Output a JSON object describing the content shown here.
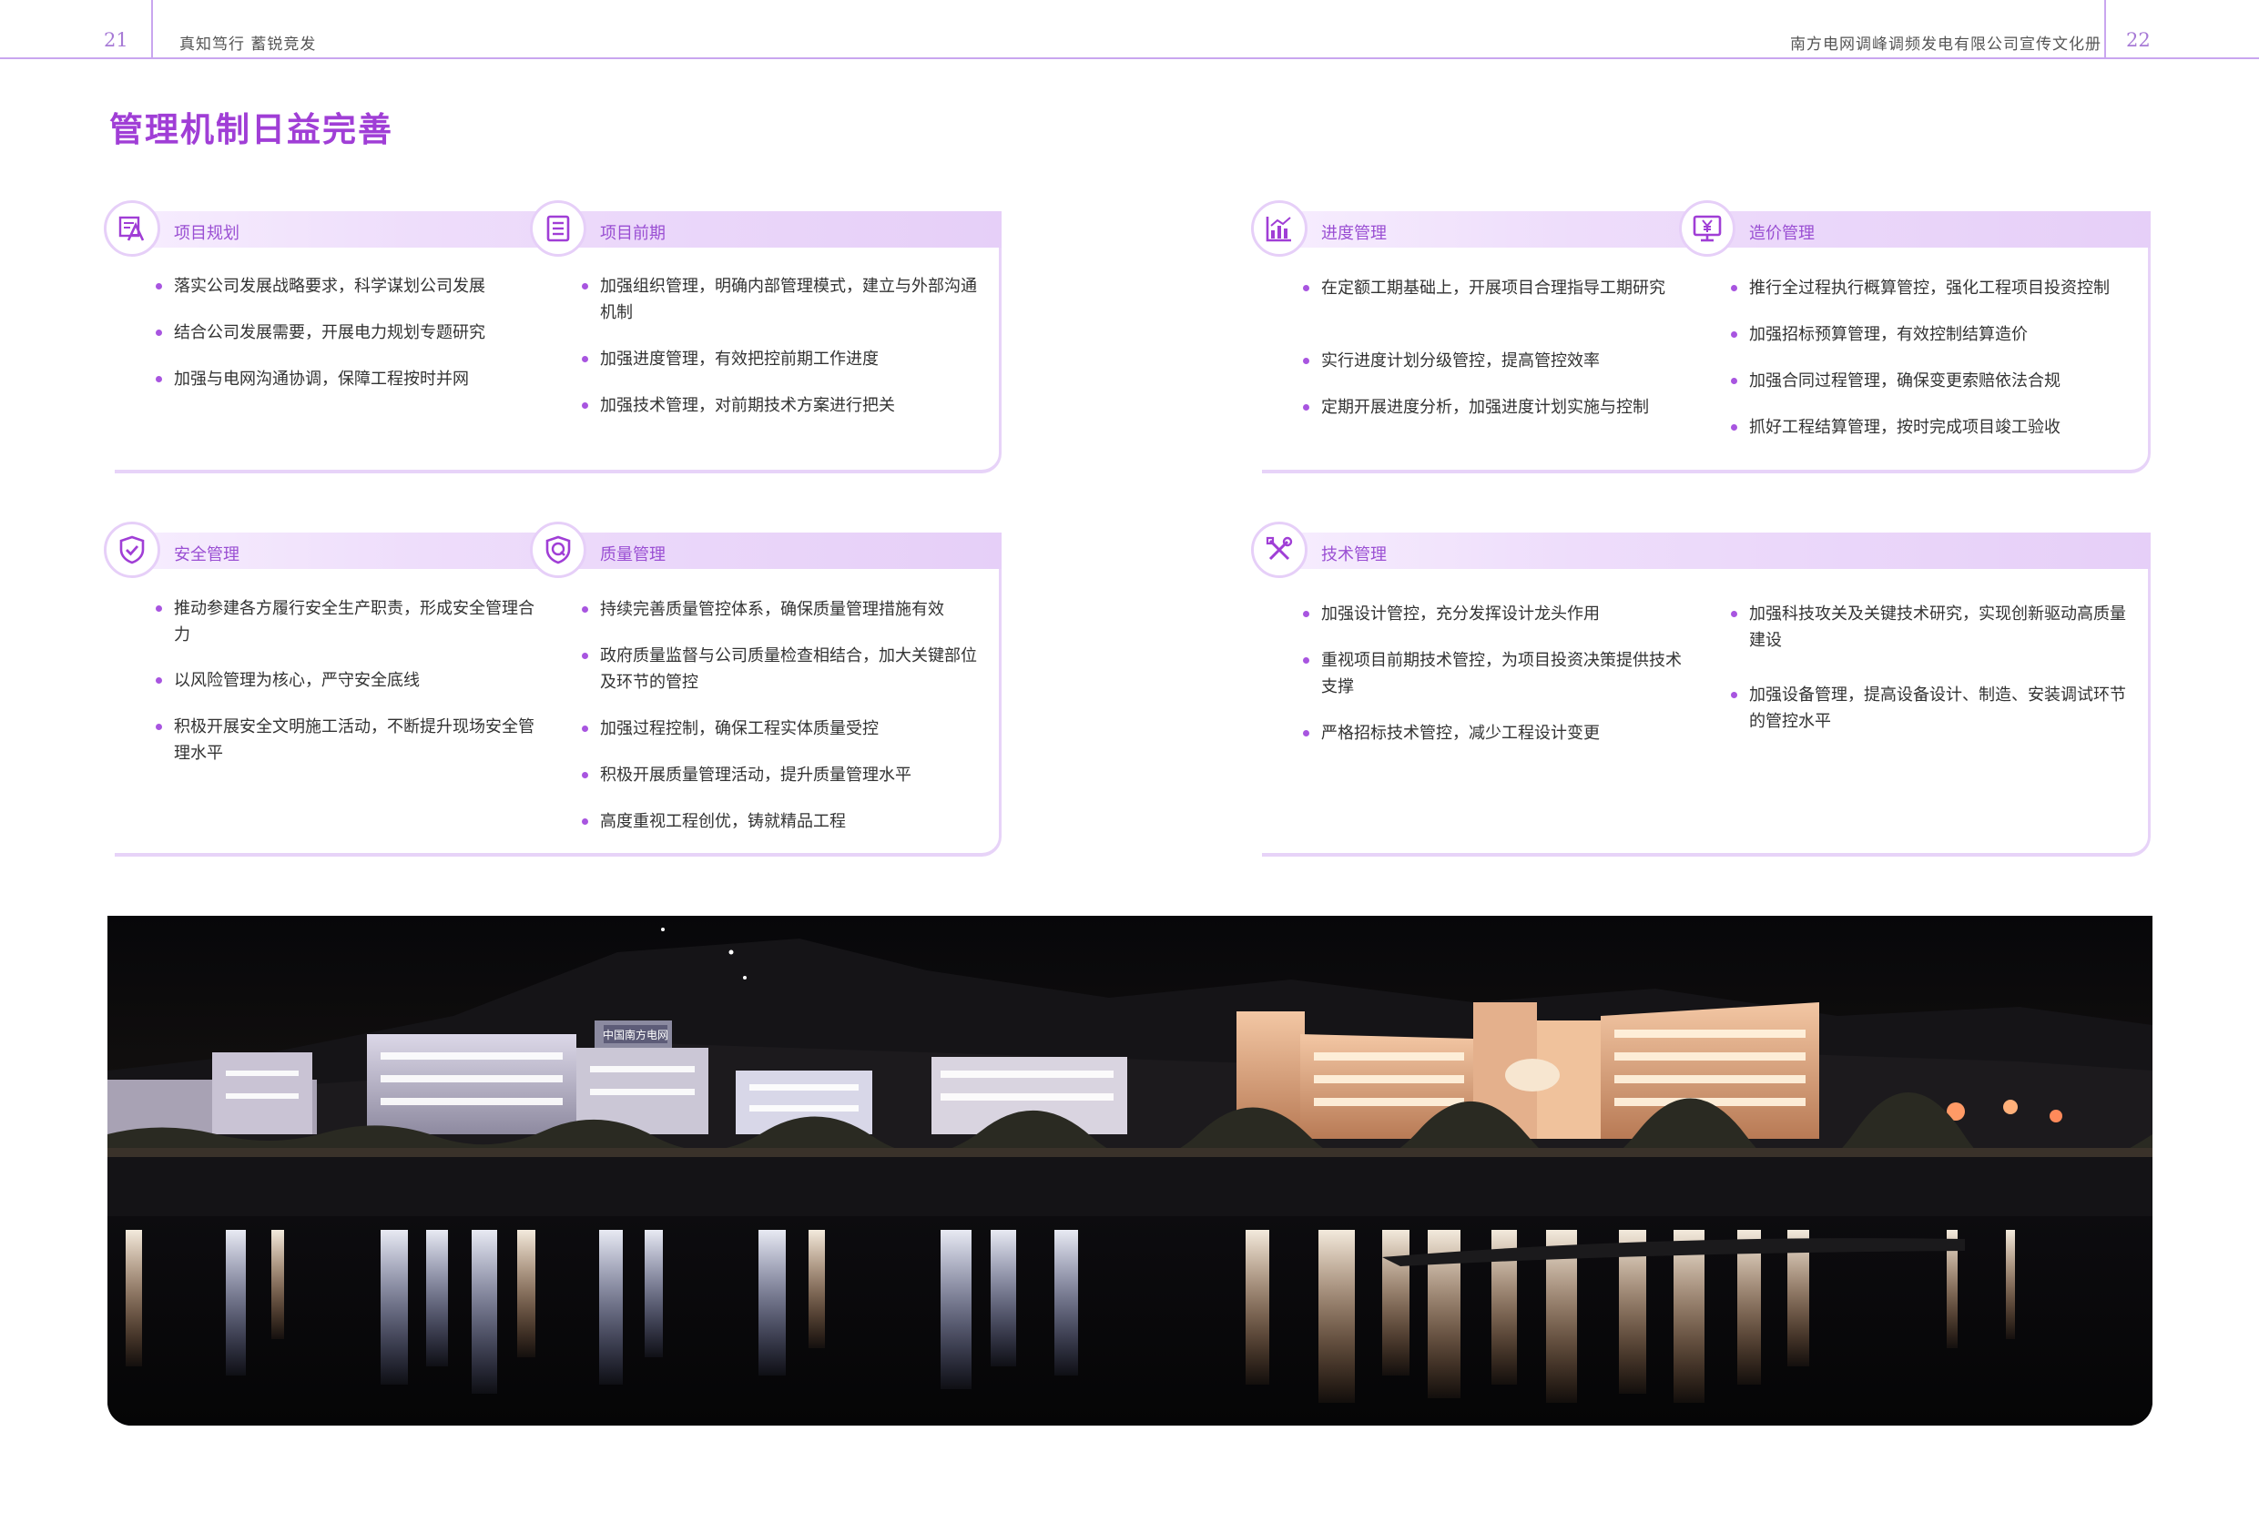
{
  "header": {
    "page_left": "21",
    "slogan": "真知笃行  蓄锐竞发",
    "company": "南方电网调峰调频发电有限公司宣传文化册",
    "page_right": "22"
  },
  "title": "管理机制日益完善",
  "colors": {
    "accent": "#a03ed6",
    "bar": "#e6cff8",
    "bullet": "#a855e0"
  },
  "sections": [
    {
      "title": "项目规划",
      "icon": "pencil-ruler-icon",
      "items": [
        "落实公司发展战略要求，科学谋划公司发展",
        "结合公司发展需要，开展电力规划专题研究",
        "加强与电网沟通协调，保障工程按时并网"
      ]
    },
    {
      "title": "项目前期",
      "icon": "document-list-icon",
      "items": [
        "加强组织管理，明确内部管理模式，建立与外部沟通机制",
        "加强进度管理，有效把控前期工作进度",
        "加强技术管理，对前期技术方案进行把关"
      ]
    },
    {
      "title": "进度管理",
      "icon": "bar-chart-icon",
      "items": [
        "在定额工期基础上，开展项目合理指导工期研究",
        "实行进度计划分级管控，提高管控效率",
        "定期开展进度分析，加强进度计划实施与控制"
      ]
    },
    {
      "title": "造价管理",
      "icon": "monitor-yen-icon",
      "items": [
        "推行全过程执行概算管控，强化工程项目投资控制",
        "加强招标预算管理，有效控制结算造价",
        "加强合同过程管理，确保变更索赔依法合规",
        "抓好工程结算管理，按时完成项目竣工验收"
      ]
    },
    {
      "title": "安全管理",
      "icon": "shield-check-icon",
      "items": [
        "推动参建各方履行安全生产职责，形成安全管理合力",
        "以风险管理为核心，严守安全底线",
        "积极开展安全文明施工活动，不断提升现场安全管理水平"
      ]
    },
    {
      "title": "质量管理",
      "icon": "quality-badge-icon",
      "items": [
        "持续完善质量管控体系，确保质量管理措施有效",
        "政府质量监督与公司质量检查相结合，加大关键部位及环节的管控",
        "加强过程控制，确保工程实体质量受控",
        "积极开展质量管理活动，提升质量管理水平",
        "高度重视工程创优，铸就精品工程"
      ]
    },
    {
      "title": "技术管理",
      "icon": "tools-icon",
      "items": [
        "加强设计管控，充分发挥设计龙头作用",
        "重视项目前期技术管控，为项目投资决策提供技术支撑",
        "严格招标技术管控，减少工程设计变更"
      ]
    },
    {
      "title": "技术管理-col2",
      "icon": "",
      "items": [
        "加强科技攻关及关键技术研究，实现创新驱动高质量建设",
        "加强设备管理，提高设备设计、制造、安装调试环节的管控水平"
      ]
    }
  ],
  "photo": {
    "description": "",
    "sign_text": "中国南方电网"
  }
}
